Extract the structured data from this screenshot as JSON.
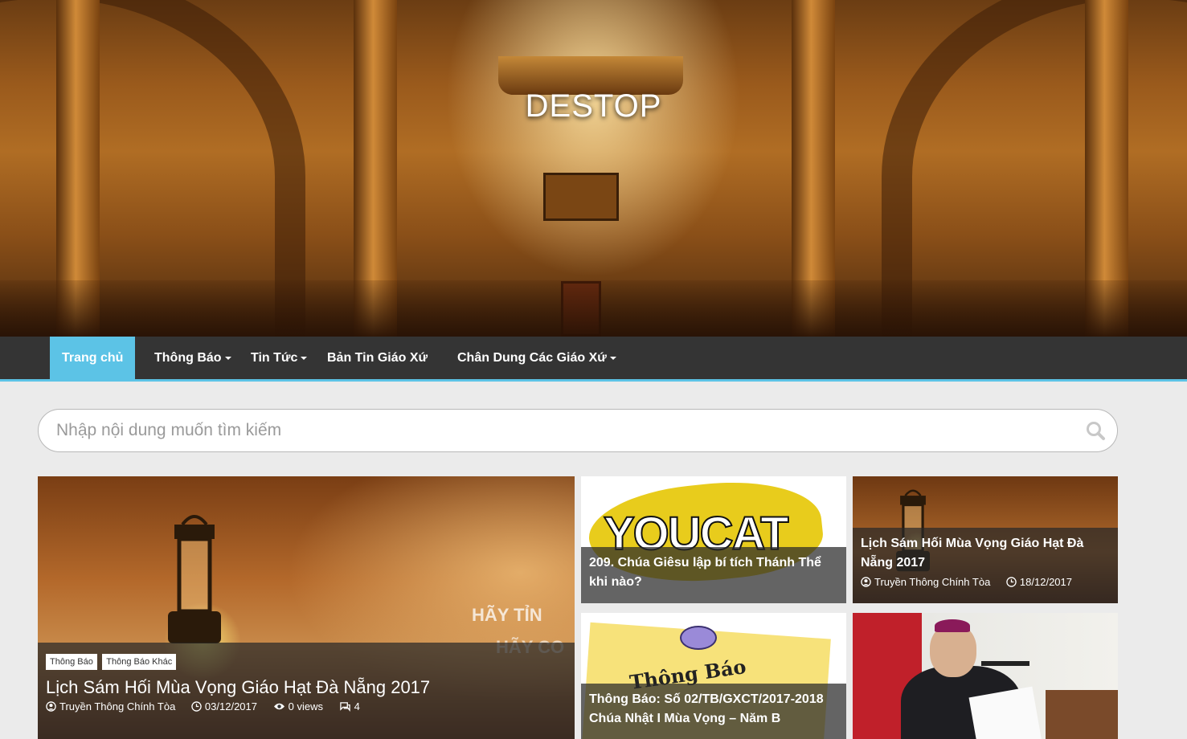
{
  "site": {
    "title": "DESTOP"
  },
  "nav": {
    "items": [
      {
        "label": "Trang chủ",
        "active": true,
        "dropdown": false
      },
      {
        "label": "Thông Báo",
        "active": false,
        "dropdown": true
      },
      {
        "label": "Tin Tức",
        "active": false,
        "dropdown": true
      },
      {
        "label": "Bản Tin Giáo Xứ",
        "active": false,
        "dropdown": false
      },
      {
        "label": "Chân Dung Các Giáo Xứ",
        "active": false,
        "dropdown": true
      }
    ]
  },
  "search": {
    "placeholder": "Nhập nội dung muốn tìm kiếm",
    "icon": "search-icon"
  },
  "featured": {
    "tags": [
      "Thông Báo",
      "Thông Báo Khác"
    ],
    "title": "Lịch Sám Hối Mùa Vọng Giáo Hạt Đà Nẵng 2017",
    "author": "Truyền Thông Chính Tòa",
    "date": "03/12/2017",
    "views": "0 views",
    "comments": "4",
    "image_text_1": "HÃY TỈN",
    "image_text_2": "HÃY CO"
  },
  "cards": [
    {
      "title": "209. Chúa Giêsu lập bí tích Thánh Thể khi nào?",
      "image_text": "YOUCAT"
    },
    {
      "title": "Lịch Sám Hối Mùa Vọng Giáo Hạt Đà Nẵng 2017",
      "author": "Truyền Thông Chính Tòa",
      "date": "18/12/2017"
    },
    {
      "title": "Thông Báo: Số 02/TB/GXCT/2017-2018 Chúa Nhật I Mùa Vọng – Năm B",
      "image_text": "Thông Báo"
    },
    {
      "title": ""
    }
  ],
  "colors": {
    "accent": "#5cc3e6",
    "nav_bg": "#343434",
    "page_bg": "#ebebeb"
  }
}
